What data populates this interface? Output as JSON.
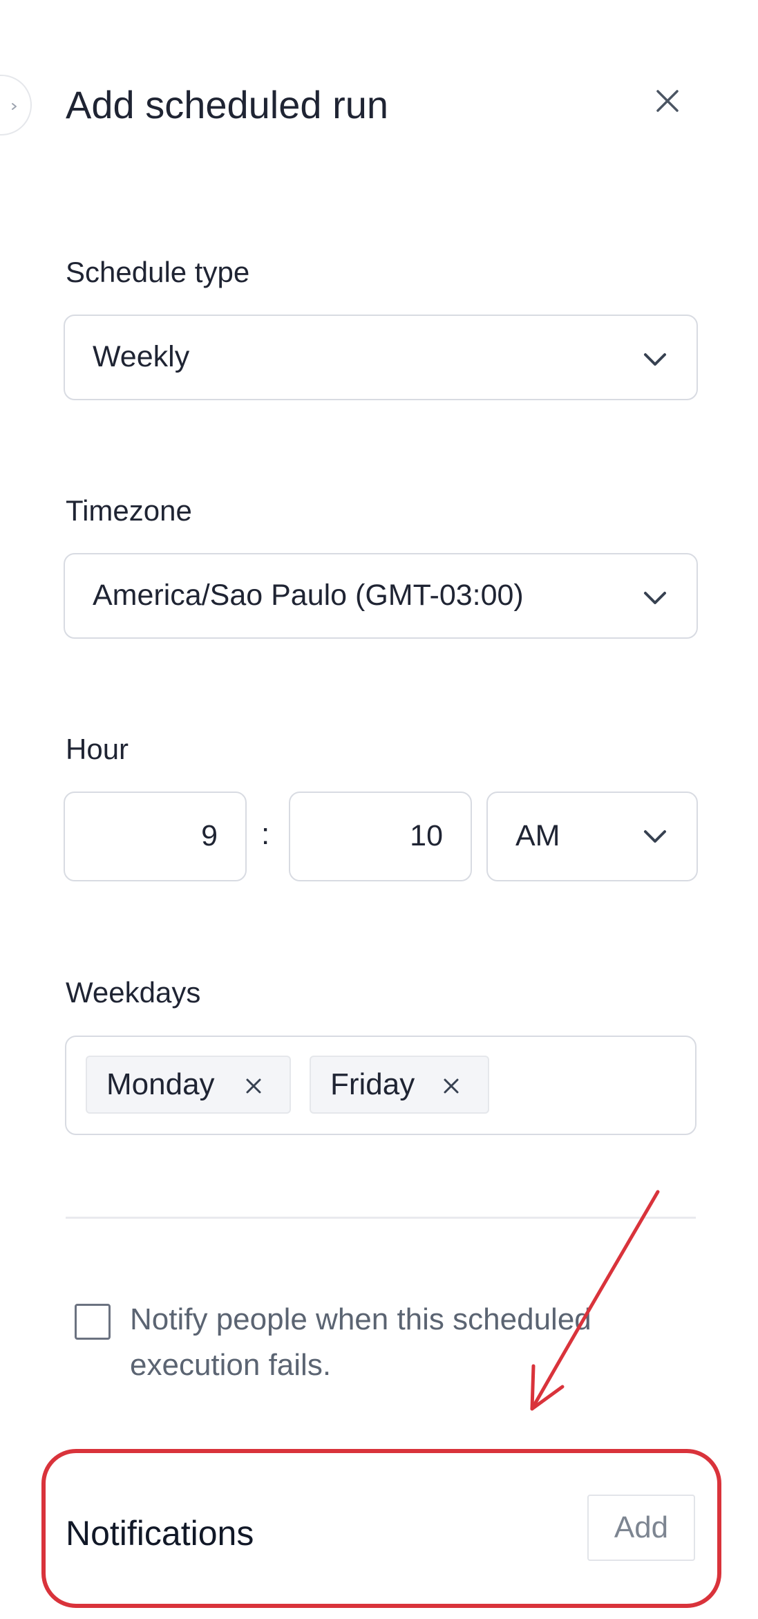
{
  "header": {
    "title": "Add scheduled run"
  },
  "schedule_type": {
    "label": "Schedule type",
    "value": "Weekly"
  },
  "timezone": {
    "label": "Timezone",
    "value": "America/Sao Paulo (GMT-03:00)"
  },
  "hour": {
    "label": "Hour",
    "hour_value": "9",
    "separator": ":",
    "minute_value": "10",
    "period": "AM"
  },
  "weekdays": {
    "label": "Weekdays",
    "tags": [
      "Monday",
      "Friday"
    ]
  },
  "notify": {
    "checked": false,
    "text": "Notify people when this scheduled execution fails."
  },
  "notifications": {
    "label": "Notifications",
    "add_label": "Add"
  },
  "colors": {
    "annotation": "#d9333b",
    "border": "#d8dbe2",
    "text": "#1f2433",
    "muted_text": "#5b6472"
  },
  "icons": {
    "back": "chevron-right-icon",
    "close": "close-icon",
    "dropdown": "chevron-down-icon",
    "tag_remove": "x-icon"
  }
}
